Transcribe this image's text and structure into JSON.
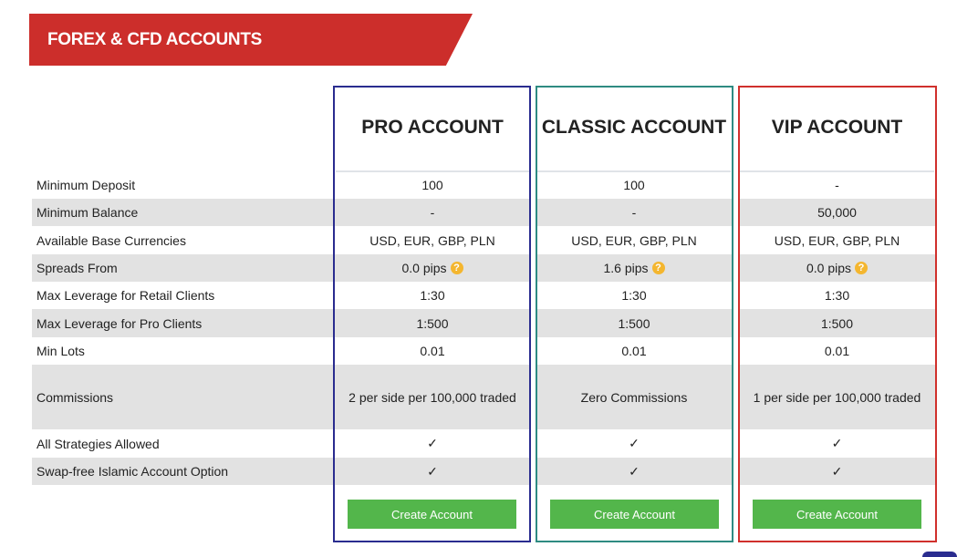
{
  "banner": {
    "title": "FOREX & CFD ACCOUNTS"
  },
  "accounts": [
    {
      "name": "PRO ACCOUNT",
      "color": "#2a2c8f",
      "button": "Create Account"
    },
    {
      "name": "CLASSIC ACCOUNT",
      "color": "#2e8b82",
      "button": "Create Account"
    },
    {
      "name": "VIP ACCOUNT",
      "color": "#d0302c",
      "button": "Create Account"
    }
  ],
  "rows": [
    {
      "label": "Minimum Deposit",
      "values": [
        "100",
        "100",
        "-"
      ]
    },
    {
      "label": "Minimum Balance",
      "values": [
        "-",
        "-",
        "50,000"
      ]
    },
    {
      "label": "Available Base Currencies",
      "values": [
        "USD, EUR, GBP, PLN",
        "USD, EUR, GBP, PLN",
        "USD, EUR, GBP, PLN"
      ]
    },
    {
      "label": "Spreads From",
      "values": [
        "0.0 pips",
        "1.6 pips",
        "0.0 pips"
      ],
      "help_icon": "?"
    },
    {
      "label": "Max Leverage for Retail Clients",
      "values": [
        "1:30",
        "1:30",
        "1:30"
      ]
    },
    {
      "label": "Max Leverage for Pro Clients",
      "values": [
        "1:500",
        "1:500",
        "1:500"
      ]
    },
    {
      "label": "Min Lots",
      "values": [
        "0.01",
        "0.01",
        "0.01"
      ]
    },
    {
      "label": "Commissions",
      "values": [
        "2 per side per 100,000 traded",
        "Zero Commissions",
        "1 per side per 100,000 traded"
      ]
    },
    {
      "label": "All Strategies Allowed",
      "values": [
        "✓",
        "✓",
        "✓"
      ]
    },
    {
      "label": "Swap-free Islamic Account Option",
      "values": [
        "✓",
        "✓",
        "✓"
      ]
    }
  ]
}
